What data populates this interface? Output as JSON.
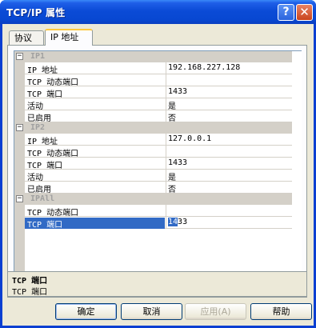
{
  "window": {
    "title": "TCP/IP 属性",
    "help_glyph": "?",
    "close_glyph": "✕"
  },
  "tabs": [
    {
      "label": "协议"
    },
    {
      "label": "IP 地址"
    }
  ],
  "grid": {
    "categories": [
      {
        "name": "IP1",
        "toggle": "⊟",
        "rows": [
          {
            "name": "IP 地址",
            "value": "192.168.227.128"
          },
          {
            "name": "TCP 动态端口",
            "value": ""
          },
          {
            "name": "TCP 端口",
            "value": "1433"
          },
          {
            "name": "活动",
            "value": "是"
          },
          {
            "name": "已启用",
            "value": "否"
          }
        ]
      },
      {
        "name": "IP2",
        "toggle": "⊟",
        "rows": [
          {
            "name": "IP 地址",
            "value": "127.0.0.1"
          },
          {
            "name": "TCP 动态端口",
            "value": ""
          },
          {
            "name": "TCP 端口",
            "value": "1433"
          },
          {
            "name": "活动",
            "value": "是"
          },
          {
            "name": "已启用",
            "value": "否"
          }
        ]
      },
      {
        "name": "IPAll",
        "toggle": "⊟",
        "rows": [
          {
            "name": "TCP 动态端口",
            "value": ""
          },
          {
            "name": "TCP 端口",
            "value": "1433",
            "selected_part": "14",
            "rest_part": "33"
          }
        ]
      }
    ]
  },
  "description": {
    "title": "TCP 端口",
    "text": "TCP 端口"
  },
  "buttons": {
    "ok": "确定",
    "cancel": "取消",
    "apply": "应用(A)",
    "help": "帮助"
  }
}
